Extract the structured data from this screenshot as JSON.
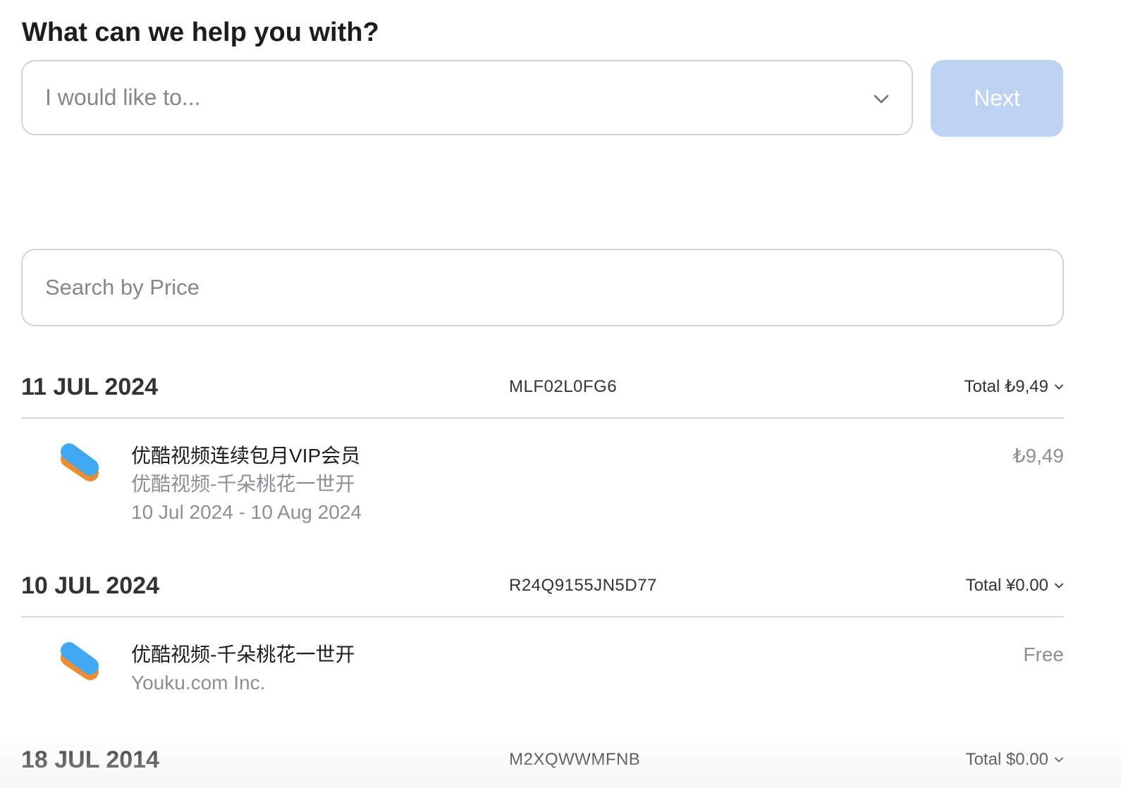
{
  "heading": "What can we help you with?",
  "select": {
    "placeholder": "I would like to..."
  },
  "next_label": "Next",
  "search": {
    "placeholder": "Search by Price"
  },
  "orders": [
    {
      "date": "11 JUL 2024",
      "order_id": "MLF02L0FG6",
      "total": "Total ₺9,49",
      "items": [
        {
          "icon": "youku-app-icon",
          "title": "优酷视频连续包月VIP会员",
          "subtitle": "优酷视频-千朵桃花一世开",
          "period": "10 Jul 2024 - 10 Aug 2024",
          "price": "₺9,49"
        }
      ]
    },
    {
      "date": "10 JUL 2024",
      "order_id": "R24Q9155JN5D77",
      "total": "Total ¥0.00",
      "items": [
        {
          "icon": "youku-app-icon",
          "title": "优酷视频-千朵桃花一世开",
          "subtitle": "Youku.com Inc.",
          "price": "Free"
        }
      ]
    },
    {
      "date": "18 JUL 2014",
      "order_id": "M2XQWWMFNB",
      "total": "Total $0.00"
    }
  ],
  "colors": {
    "next_button_bg": "#bcd3f3",
    "youku_blue": "#3fa9f5",
    "youku_orange": "#f28a2e"
  }
}
